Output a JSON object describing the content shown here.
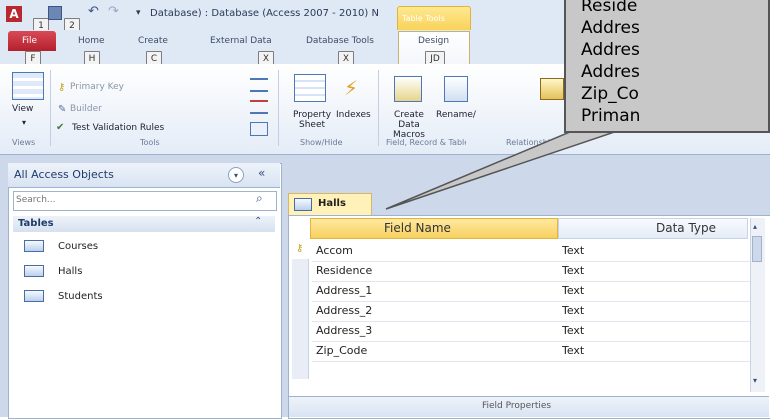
{
  "titlebar": {
    "app_icon_letter": "A",
    "title": "Database) : Database (Access 2007 - 2010) N",
    "contextual_tab_label": "Table Tools",
    "keytips": [
      "1",
      "2"
    ]
  },
  "tabs": [
    {
      "label": "File",
      "keytip": "F"
    },
    {
      "label": "Home",
      "keytip": "H"
    },
    {
      "label": "Create",
      "keytip": "C"
    },
    {
      "label": "External Data",
      "keytip": "X"
    },
    {
      "label": "Database Tools",
      "keytip": "X"
    },
    {
      "label": "Design",
      "keytip": "JD"
    }
  ],
  "ribbon": {
    "view_label": "View",
    "views_group": "Views",
    "primary_key": "Primary Key",
    "builder": "Builder",
    "test_validation": "Test Validation Rules",
    "tools_group": "Tools",
    "property_sheet": "Property Sheet",
    "indexes": "Indexes",
    "showhide_group": "Show/Hide",
    "create_data_macros": "Create Data Macros",
    "rename_delete": "Rename/",
    "field_group": "Field, Record & Table Events",
    "relationships_group": "Relationships"
  },
  "nav": {
    "title": "All Access Objects",
    "search_placeholder": "Search...",
    "section": "Tables",
    "items": [
      "Courses",
      "Halls",
      "Students"
    ]
  },
  "document": {
    "tab_label": "Halls",
    "col_field_name": "Field Name",
    "col_data_type": "Data Type",
    "rows": [
      {
        "field": "Accom",
        "type": "Text"
      },
      {
        "field": "Residence",
        "type": "Text"
      },
      {
        "field": "Address_1",
        "type": "Text"
      },
      {
        "field": "Address_2",
        "type": "Text"
      },
      {
        "field": "Address_3",
        "type": "Text"
      },
      {
        "field": "Zip_Code",
        "type": "Text"
      }
    ],
    "field_properties": "Field Properties"
  },
  "callout": {
    "lines": [
      "Reside",
      "Addres",
      "Addres",
      "Addres",
      "Zip_Co",
      "Priman"
    ]
  }
}
